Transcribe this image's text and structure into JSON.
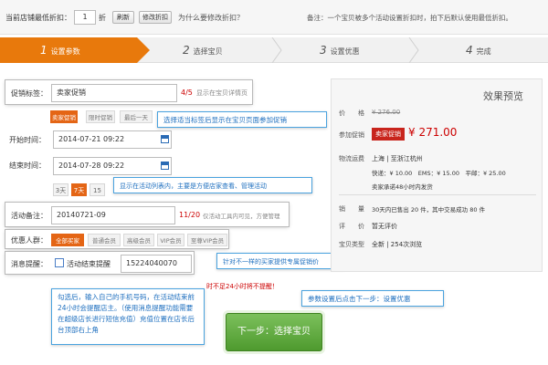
{
  "topbar": {
    "min_discount_label": "当前店铺最低折扣：",
    "min_discount_value": "1",
    "discount_unit": "折",
    "refresh_label": "刷新",
    "modify_label": "修改折扣",
    "why_label": "为什么要修改折扣？",
    "note": "备注：一个宝贝被多个活动设置折扣时，拍下后默认使用最低折扣。"
  },
  "steps": [
    {
      "num": "1",
      "label": "设置参数"
    },
    {
      "num": "2",
      "label": "选择宝贝"
    },
    {
      "num": "3",
      "label": "设置优惠"
    },
    {
      "num": "4",
      "label": "完成"
    }
  ],
  "form": {
    "promo_tag_label": "促销标签：",
    "promo_tag_value": "卖家促销",
    "promo_tag_count": "4/5",
    "promo_tag_hint": "显示在宝贝详情页",
    "tag_options": [
      "卖家促销",
      "限时促销",
      "最后一天"
    ],
    "start_label": "开始时间：",
    "start_value": "2014-07-21 09:22",
    "end_label": "结束时间：",
    "end_value": "2014-07-28 09:22",
    "day_options": [
      "3天",
      "7天",
      "15"
    ],
    "remark_label": "活动备注：",
    "remark_value": "20140721-09",
    "remark_count": "11/20",
    "remark_hint": "仅活动工具内可见，方便管理",
    "crowd_label": "优惠人群：",
    "crowd_options": [
      "全部买家",
      "普通会员",
      "高级会员",
      "VIP会员",
      "至尊VIP会员"
    ],
    "remind_label": "消息提醒：",
    "remind_checkbox_label": "活动结束提醒",
    "phone_value": "15224040070",
    "warn_text": "时不足24小时将不提醒！"
  },
  "tips": {
    "tag_tip": "选择适当标签后显示在宝贝页面参加促销",
    "remark_tip": "显示在活动列表内，主要是方便店家查看、管理活动",
    "crowd_tip": "针对不一样的买家提供专属促销价",
    "remind_tip": "勾选后，输入自己的手机号码，在活动结束前24小时会提醒店主。（使用消息提醒功能需要在超级店长进行短信充值）充值位置在店长后台顶部右上角",
    "next_tip": "参数设置后点击下一步：设置优惠"
  },
  "preview": {
    "title": "效果预览",
    "price_label": "价　　格",
    "price_value": "¥ 276.00",
    "promo_label": "参加促销",
    "promo_badge": "卖家促销",
    "promo_price": "¥ 271.00",
    "logistics_label": "物流运费",
    "logistics_route": "上海 | 至浙江杭州",
    "shipping_line": "快递：¥ 10.00　EMS：¥ 15.00　平邮：¥ 25.00",
    "shipping_note": "卖家承诺48小时内发货",
    "sales_label": "销　　量",
    "sales_value": "30天内已售出 20 件，其中交易成功 80 件",
    "review_label": "评　　价",
    "review_value": "暂无评价",
    "info_label": "宝贝类型",
    "info_value": "全新 | 254次浏览"
  },
  "next_button": "下一步：选择宝贝",
  "colors": {
    "accent": "#e8790c",
    "green": "#5aa63a",
    "tip_border": "#4aa3df",
    "price_red": "#cc0000"
  }
}
